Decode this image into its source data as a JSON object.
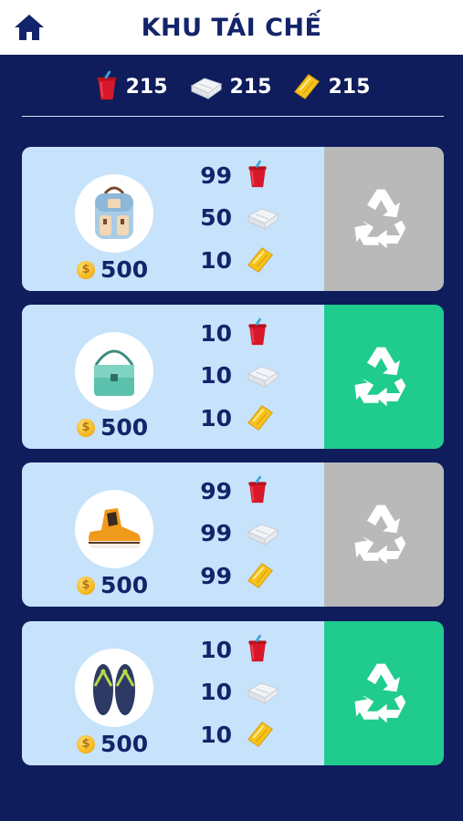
{
  "header": {
    "title": "KHU TÁI CHẾ",
    "home_icon": "home-icon"
  },
  "resources": [
    {
      "icon": "cup-icon",
      "count": "215"
    },
    {
      "icon": "paper-icon",
      "count": "215"
    },
    {
      "icon": "wrapper-icon",
      "count": "215"
    }
  ],
  "colors": {
    "background": "#0f1d5c",
    "card": "#c7e2fb",
    "recycle_enabled": "#1fcc8d",
    "recycle_disabled": "#b9b9b9",
    "text": "#13246a"
  },
  "items": [
    {
      "icon": "backpack-icon",
      "price": "500",
      "requirements": {
        "cup": "99",
        "paper": "50",
        "wrapper": "10"
      },
      "recycle_enabled": false,
      "recycle_icon": "recycle-icon"
    },
    {
      "icon": "shoulder-bag-icon",
      "price": "500",
      "requirements": {
        "cup": "10",
        "paper": "10",
        "wrapper": "10"
      },
      "recycle_enabled": true,
      "recycle_icon": "recycle-icon"
    },
    {
      "icon": "sneaker-icon",
      "price": "500",
      "requirements": {
        "cup": "99",
        "paper": "99",
        "wrapper": "99"
      },
      "recycle_enabled": false,
      "recycle_icon": "recycle-icon"
    },
    {
      "icon": "flip-flops-icon",
      "price": "500",
      "requirements": {
        "cup": "10",
        "paper": "10",
        "wrapper": "10"
      },
      "recycle_enabled": true,
      "recycle_icon": "recycle-icon"
    }
  ]
}
